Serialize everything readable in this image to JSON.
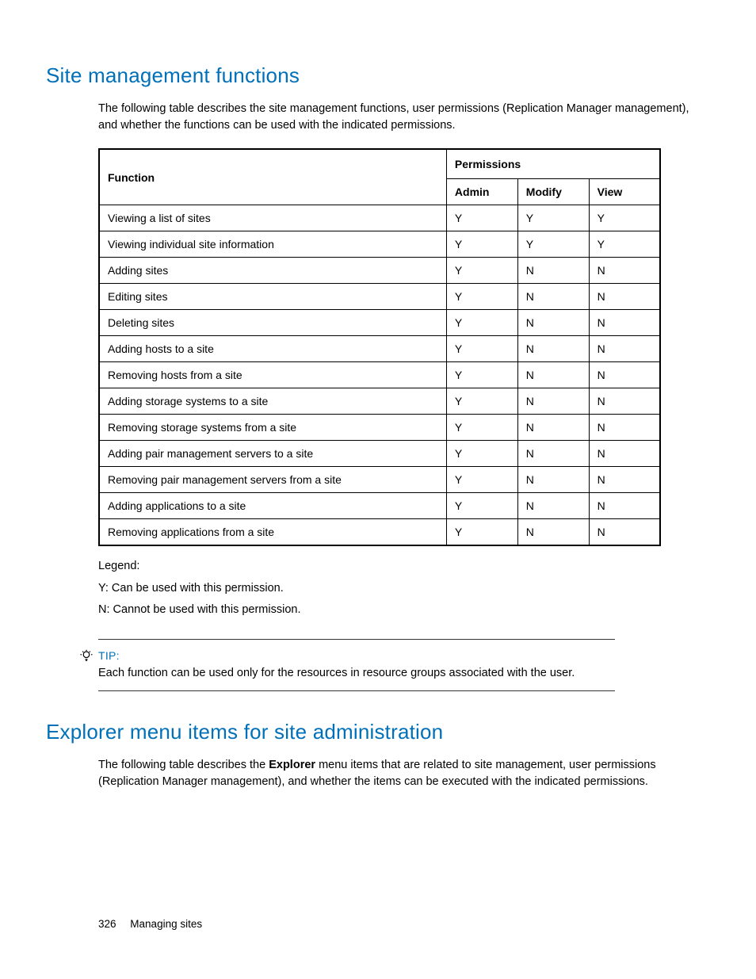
{
  "section1": {
    "heading": "Site management functions",
    "intro": "The following table describes the site management functions, user permissions (Replication Manager management), and whether the functions can be used with the indicated permissions."
  },
  "table": {
    "headers": {
      "function": "Function",
      "permissions": "Permissions",
      "admin": "Admin",
      "modify": "Modify",
      "view": "View"
    },
    "rows": [
      {
        "fn": "Viewing a list of sites",
        "admin": "Y",
        "modify": "Y",
        "view": "Y"
      },
      {
        "fn": "Viewing individual site information",
        "admin": "Y",
        "modify": "Y",
        "view": "Y"
      },
      {
        "fn": "Adding sites",
        "admin": "Y",
        "modify": "N",
        "view": "N"
      },
      {
        "fn": "Editing sites",
        "admin": "Y",
        "modify": "N",
        "view": "N"
      },
      {
        "fn": "Deleting sites",
        "admin": "Y",
        "modify": "N",
        "view": "N"
      },
      {
        "fn": "Adding hosts to a site",
        "admin": "Y",
        "modify": "N",
        "view": "N"
      },
      {
        "fn": "Removing hosts from a site",
        "admin": "Y",
        "modify": "N",
        "view": "N"
      },
      {
        "fn": "Adding storage systems to a site",
        "admin": "Y",
        "modify": "N",
        "view": "N"
      },
      {
        "fn": "Removing storage systems from a site",
        "admin": "Y",
        "modify": "N",
        "view": "N"
      },
      {
        "fn": "Adding pair management servers to a site",
        "admin": "Y",
        "modify": "N",
        "view": "N"
      },
      {
        "fn": "Removing pair management servers from a site",
        "admin": "Y",
        "modify": "N",
        "view": "N"
      },
      {
        "fn": "Adding applications to a site",
        "admin": "Y",
        "modify": "N",
        "view": "N"
      },
      {
        "fn": "Removing applications from a site",
        "admin": "Y",
        "modify": "N",
        "view": "N"
      }
    ]
  },
  "legend": {
    "title": "Legend:",
    "y": "Y: Can be used with this permission.",
    "n": "N: Cannot be used with this permission."
  },
  "tip": {
    "label": "TIP:",
    "text": "Each function can be used only for the resources in resource groups associated with the user."
  },
  "section2": {
    "heading": "Explorer menu items for site administration",
    "intro_pre": "The following table describes the ",
    "intro_bold": "Explorer",
    "intro_post": " menu items that are related to site management, user permissions (Replication Manager management), and whether the items can be executed with the indicated permissions."
  },
  "footer": {
    "page": "326",
    "chapter": "Managing sites"
  }
}
